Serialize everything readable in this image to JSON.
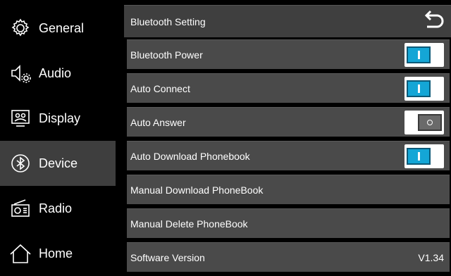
{
  "sidebar": {
    "items": [
      {
        "label": "General",
        "icon": "gear-icon"
      },
      {
        "label": "Audio",
        "icon": "speaker-gear-icon"
      },
      {
        "label": "Display",
        "icon": "display-icon"
      },
      {
        "label": "Device",
        "icon": "bluetooth-icon",
        "active": true
      },
      {
        "label": "Radio",
        "icon": "radio-icon"
      },
      {
        "label": "Home",
        "icon": "home-icon"
      }
    ]
  },
  "header": {
    "title": "Bluetooth Setting",
    "back_icon": "back-arrow-icon"
  },
  "settings": {
    "bluetooth_power": {
      "label": "Bluetooth Power",
      "state": "on"
    },
    "auto_connect": {
      "label": "Auto Connect",
      "state": "on"
    },
    "auto_answer": {
      "label": "Auto Answer",
      "state": "off"
    },
    "auto_download_phonebook": {
      "label": "Auto Download Phonebook",
      "state": "on"
    },
    "manual_download_phonebook": {
      "label": "Manual Download PhoneBook"
    },
    "manual_delete_phonebook": {
      "label": "Manual Delete PhoneBook"
    },
    "software_version": {
      "label": "Software Version",
      "value": "V1.34"
    }
  },
  "colors": {
    "toggle_on": "#14a6d6",
    "active_sidebar": "#3e3e3e",
    "row_bg": "#4a4a4a"
  }
}
